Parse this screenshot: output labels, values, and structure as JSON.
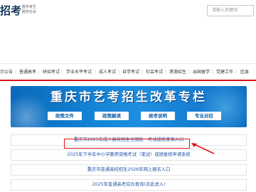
{
  "header": {
    "logo_text": "招考",
    "slogan_line1": "服务考生",
    "slogan_line2": "服务社会",
    "search_placeholder": "请输入关键词"
  },
  "nav": {
    "items": [
      {
        "label": "示公告"
      },
      {
        "label": "普通高考"
      },
      {
        "label": "研招考试"
      },
      {
        "label": "学业水平考试"
      },
      {
        "label": "成人考试"
      },
      {
        "label": "自学考试"
      },
      {
        "label": "社会考试"
      },
      {
        "label": "港澳招生"
      },
      {
        "label": "出国留学"
      },
      {
        "label": "党建工作"
      },
      {
        "label": "区县"
      }
    ]
  },
  "banner": {
    "title": "重庆市艺考招生改革专栏",
    "buttons": [
      {
        "label": "政策文件"
      },
      {
        "label": "政策解读"
      },
      {
        "label": "统考说明"
      },
      {
        "label": "专业对应"
      }
    ]
  },
  "links": [
    {
      "label": "重庆市2025年成人高校招生全国统一考试成绩查询入口"
    },
    {
      "label": "2025年下半年中小学教师资格考试（笔试）成绩复核申请系统"
    },
    {
      "label": "重庆市普通高校招生2026年网上报名入口"
    },
    {
      "label": "2025年普通高考综合查询(点此进入)"
    }
  ],
  "colors": {
    "accent_red": "#d6121b",
    "banner_blue": "#1484d6",
    "link_blue": "#2457a8"
  }
}
